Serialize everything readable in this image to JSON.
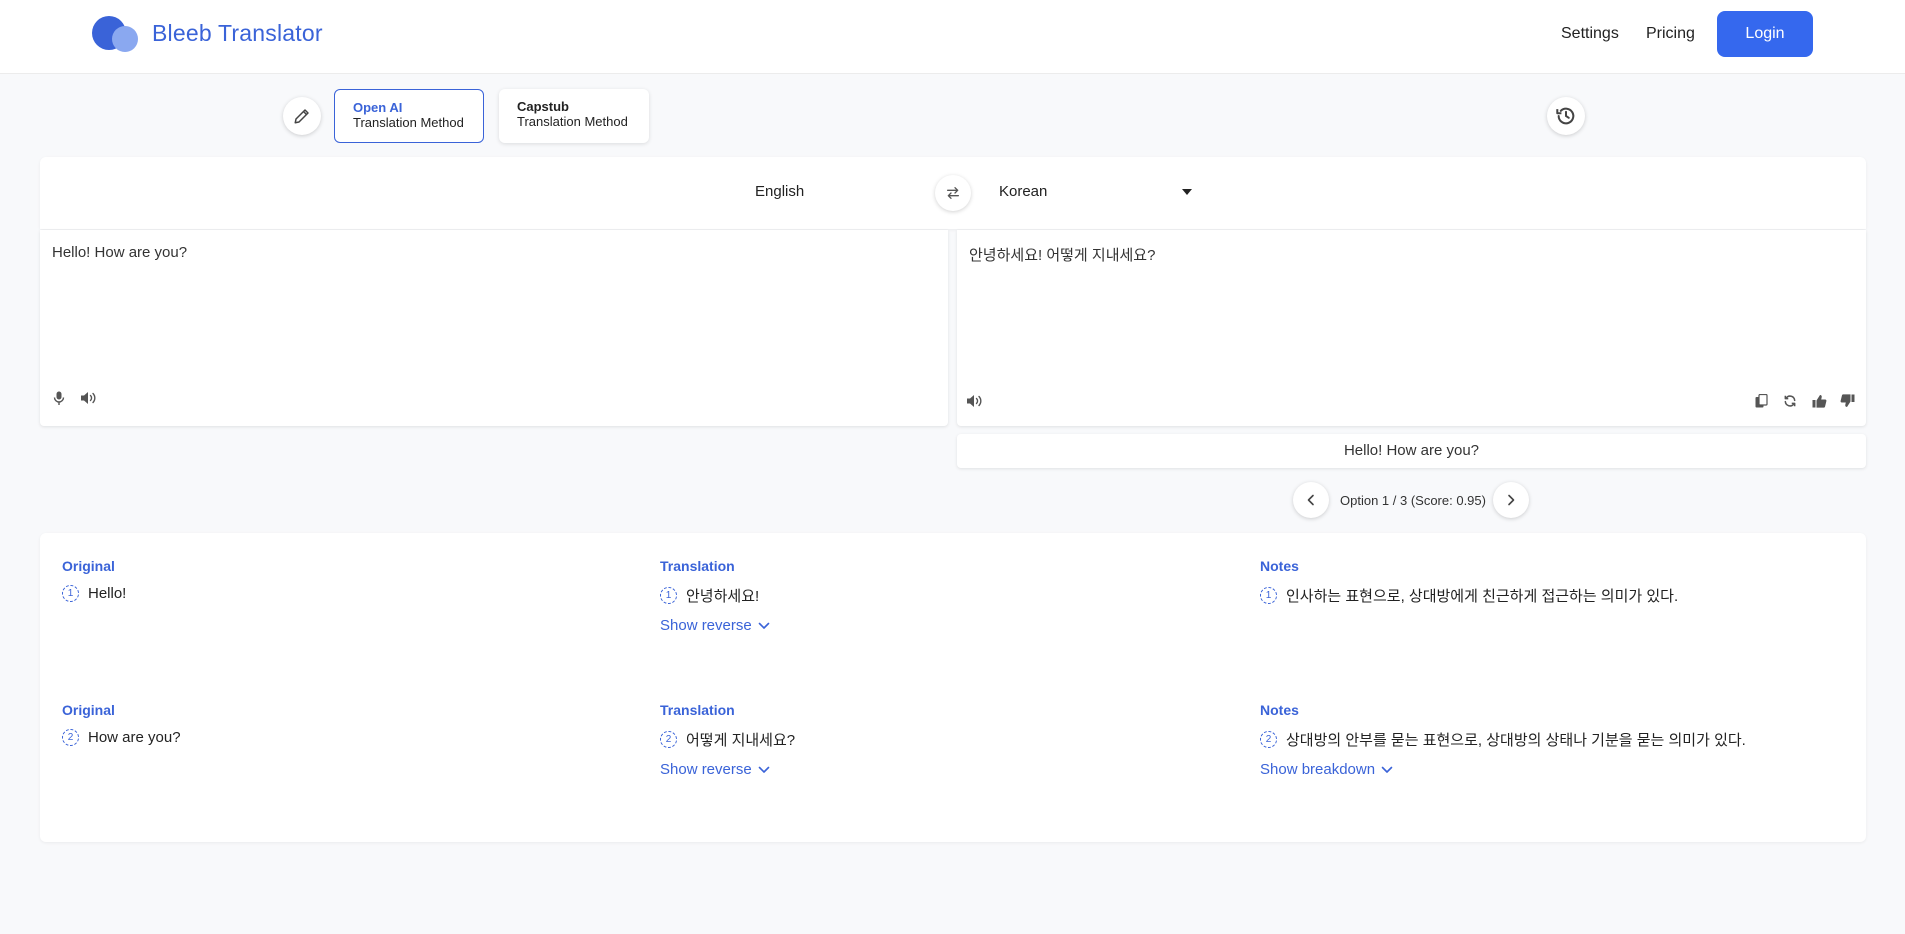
{
  "header": {
    "brand": "Bleeb Translator",
    "nav": {
      "settings": "Settings",
      "pricing": "Pricing"
    },
    "login_label": "Login"
  },
  "methods": [
    {
      "name": "Open AI",
      "sub": "Translation Method",
      "active": true
    },
    {
      "name": "Capstub",
      "sub": "Translation Method",
      "active": false
    }
  ],
  "languages": {
    "source": "English",
    "target": "Korean"
  },
  "source_text": "Hello! How are you?",
  "translated_text": "안녕하세요! 어떻게 지내세요?",
  "reverse_translation": "Hello! How are you?",
  "option_label": "Option 1 / 3 (Score: 0.95)",
  "breakdown": {
    "headers": {
      "original": "Original",
      "translation": "Translation",
      "notes": "Notes"
    },
    "rows": [
      {
        "num": "1",
        "original": "Hello!",
        "translation": "안녕하세요!",
        "notes": "인사하는 표현으로, 상대방에게 친근하게 접근하는 의미가 있다.",
        "translation_link": "Show reverse"
      },
      {
        "num": "2",
        "original": "How are you?",
        "translation": "어떻게 지내세요?",
        "notes": "상대방의 안부를 묻는 표현으로, 상대방의 상태나 기분을 묻는 의미가 있다.",
        "translation_link": "Show reverse",
        "notes_link": "Show breakdown"
      }
    ]
  },
  "colors": {
    "accent": "#3a63d8",
    "button": "#3568ee",
    "background": "#f8f9fb"
  }
}
